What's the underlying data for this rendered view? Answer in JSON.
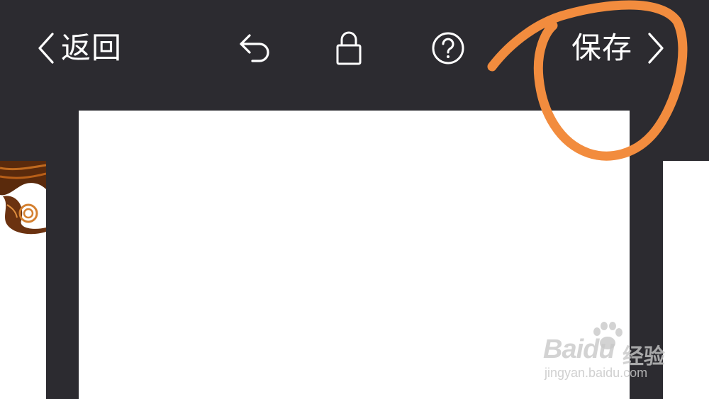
{
  "toolbar": {
    "back_label": "返回",
    "save_label": "保存",
    "icons": [
      "chevron-left-icon",
      "undo-icon",
      "lock-icon",
      "help-icon",
      "chevron-right-icon"
    ]
  },
  "watermark": {
    "brand": "Baidu",
    "brand_cn": "经验",
    "url": "jingyan.baidu.com"
  },
  "colors": {
    "toolbar_bg": "#2c2b30",
    "canvas": "#ffffff",
    "annotation": "#f28c3e"
  }
}
